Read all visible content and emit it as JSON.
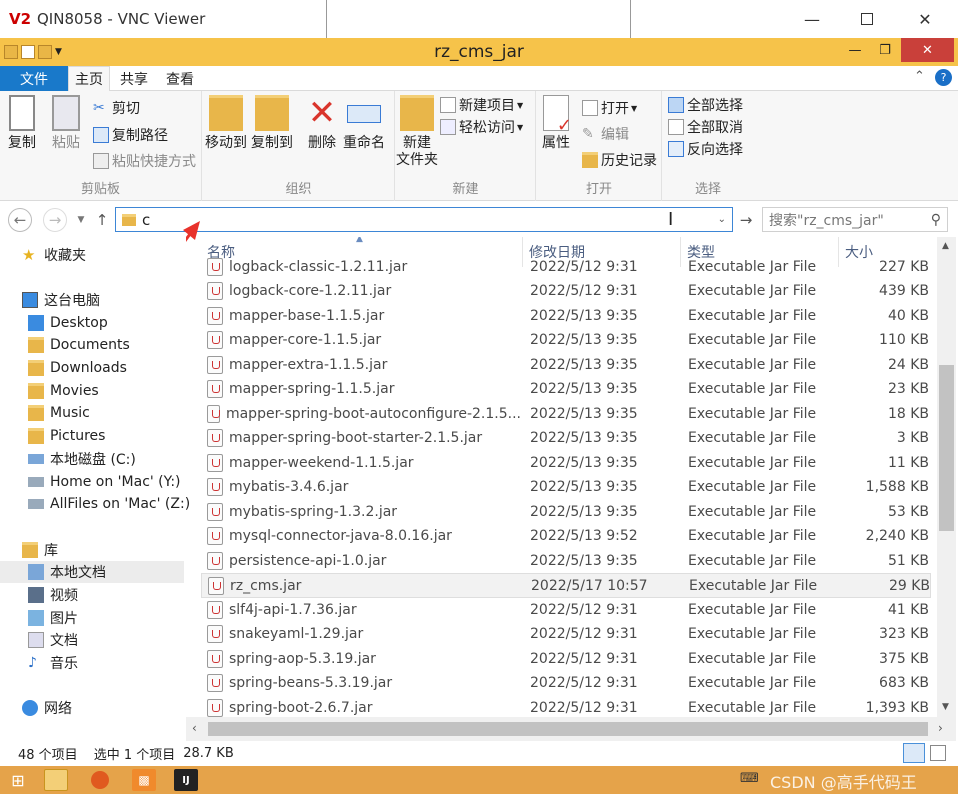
{
  "vnc": {
    "title": "QIN8058 - VNC Viewer",
    "logo": "V2"
  },
  "window": {
    "title": "rz_cms_jar"
  },
  "ribbon_tabs": [
    "文件",
    "主页",
    "共享",
    "查看"
  ],
  "ribbon": {
    "clipboard": {
      "copy": "复制",
      "paste": "粘贴",
      "cut": "剪切",
      "copy_path": "复制路径",
      "paste_shortcut": "粘贴快捷方式",
      "label": "剪贴板"
    },
    "organize": {
      "move_to": "移动到",
      "copy_to": "复制到",
      "delete": "删除",
      "rename": "重命名",
      "label": "组织"
    },
    "new": {
      "new_folder_line1": "新建",
      "new_folder_line2": "文件夹",
      "new_item": "新建项目",
      "easy_access": "轻松访问",
      "label": "新建"
    },
    "open": {
      "properties": "属性",
      "open": "打开",
      "edit": "编辑",
      "history": "历史记录",
      "label": "打开"
    },
    "select": {
      "select_all": "全部选择",
      "select_none": "全部取消",
      "invert": "反向选择",
      "label": "选择"
    }
  },
  "address": {
    "value": "c",
    "search_placeholder": "搜索\"rz_cms_jar\""
  },
  "nav": {
    "favorites": "收藏夹",
    "this_pc": "这台电脑",
    "pc_items": [
      "Desktop",
      "Documents",
      "Downloads",
      "Movies",
      "Music",
      "Pictures",
      "本地磁盘 (C:)",
      "Home on 'Mac' (Y:)",
      "AllFiles on 'Mac' (Z:)"
    ],
    "library": "库",
    "library_items": [
      "本地文档",
      "视频",
      "图片",
      "文档",
      "音乐"
    ],
    "network": "网络"
  },
  "columns": {
    "name": "名称",
    "date": "修改日期",
    "type": "类型",
    "size": "大小"
  },
  "files": [
    {
      "name": "logback-classic-1.2.11.jar",
      "date": "2022/5/12 9:31",
      "type": "Executable Jar File",
      "size": "227 KB"
    },
    {
      "name": "logback-core-1.2.11.jar",
      "date": "2022/5/12 9:31",
      "type": "Executable Jar File",
      "size": "439 KB"
    },
    {
      "name": "mapper-base-1.1.5.jar",
      "date": "2022/5/13 9:35",
      "type": "Executable Jar File",
      "size": "40 KB"
    },
    {
      "name": "mapper-core-1.1.5.jar",
      "date": "2022/5/13 9:35",
      "type": "Executable Jar File",
      "size": "110 KB"
    },
    {
      "name": "mapper-extra-1.1.5.jar",
      "date": "2022/5/13 9:35",
      "type": "Executable Jar File",
      "size": "24 KB"
    },
    {
      "name": "mapper-spring-1.1.5.jar",
      "date": "2022/5/13 9:35",
      "type": "Executable Jar File",
      "size": "23 KB"
    },
    {
      "name": "mapper-spring-boot-autoconfigure-2.1.5...",
      "date": "2022/5/13 9:35",
      "type": "Executable Jar File",
      "size": "18 KB"
    },
    {
      "name": "mapper-spring-boot-starter-2.1.5.jar",
      "date": "2022/5/13 9:35",
      "type": "Executable Jar File",
      "size": "3 KB"
    },
    {
      "name": "mapper-weekend-1.1.5.jar",
      "date": "2022/5/13 9:35",
      "type": "Executable Jar File",
      "size": "11 KB"
    },
    {
      "name": "mybatis-3.4.6.jar",
      "date": "2022/5/13 9:35",
      "type": "Executable Jar File",
      "size": "1,588 KB"
    },
    {
      "name": "mybatis-spring-1.3.2.jar",
      "date": "2022/5/13 9:35",
      "type": "Executable Jar File",
      "size": "53 KB"
    },
    {
      "name": "mysql-connector-java-8.0.16.jar",
      "date": "2022/5/13 9:52",
      "type": "Executable Jar File",
      "size": "2,240 KB"
    },
    {
      "name": "persistence-api-1.0.jar",
      "date": "2022/5/13 9:35",
      "type": "Executable Jar File",
      "size": "51 KB"
    },
    {
      "name": "rz_cms.jar",
      "date": "2022/5/17 10:57",
      "type": "Executable Jar File",
      "size": "29 KB"
    },
    {
      "name": "slf4j-api-1.7.36.jar",
      "date": "2022/5/12 9:31",
      "type": "Executable Jar File",
      "size": "41 KB"
    },
    {
      "name": "snakeyaml-1.29.jar",
      "date": "2022/5/12 9:31",
      "type": "Executable Jar File",
      "size": "323 KB"
    },
    {
      "name": "spring-aop-5.3.19.jar",
      "date": "2022/5/12 9:31",
      "type": "Executable Jar File",
      "size": "375 KB"
    },
    {
      "name": "spring-beans-5.3.19.jar",
      "date": "2022/5/12 9:31",
      "type": "Executable Jar File",
      "size": "683 KB"
    },
    {
      "name": "spring-boot-2.6.7.jar",
      "date": "2022/5/12 9:31",
      "type": "Executable Jar File",
      "size": "1,393 KB"
    }
  ],
  "status": {
    "count": "48 个项目",
    "selected": "选中 1 个项目",
    "size": "28.7 KB"
  },
  "watermark": "CSDN @高手代码王"
}
